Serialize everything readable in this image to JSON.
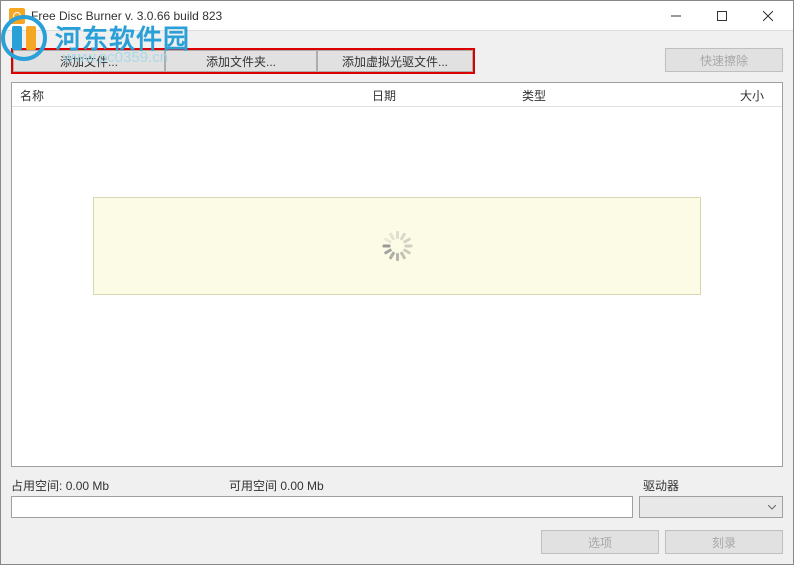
{
  "window": {
    "title": "Free Disc Burner   v. 3.0.66 build 823"
  },
  "watermark": {
    "text": "河东软件园",
    "url": "www.pc0359.cn"
  },
  "toolbar": {
    "add_file": "添加文件...",
    "add_folder": "添加文件夹...",
    "add_iso": "添加虚拟光驱文件...",
    "quick_erase": "快速擦除"
  },
  "columns": {
    "name": "名称",
    "date": "日期",
    "type": "类型",
    "size": "大小"
  },
  "status": {
    "used_label": "占用空间:",
    "used_value": "0.00 Mb",
    "free_label": "可用空间",
    "free_value": "0.00 Mb",
    "drive_label": "驱动器"
  },
  "actions": {
    "options": "选项",
    "burn": "刻录"
  }
}
